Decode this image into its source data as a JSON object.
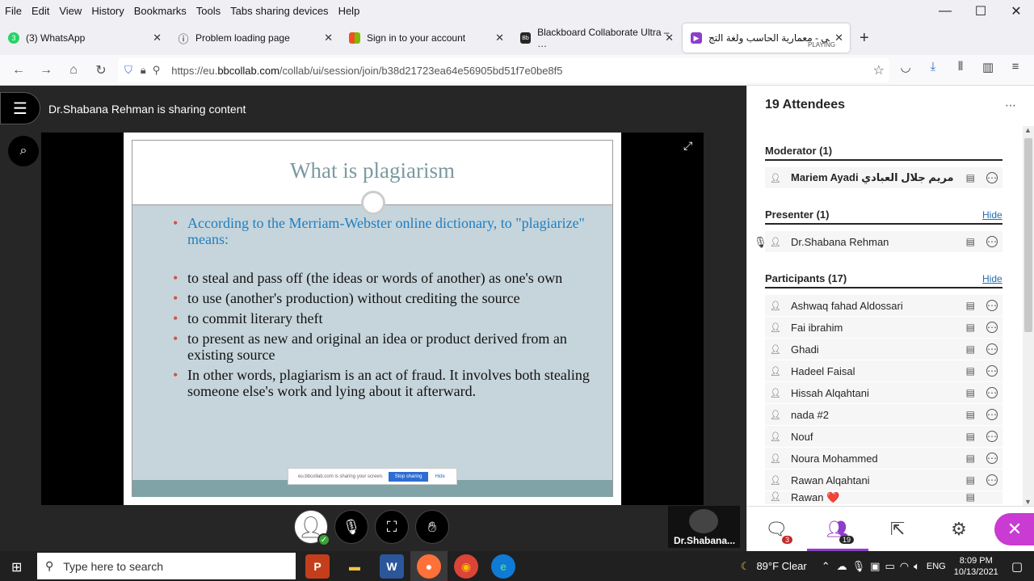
{
  "menubar": {
    "items": [
      "File",
      "Edit",
      "View",
      "History",
      "Bookmarks",
      "Tools",
      "Tabs sharing devices",
      "Help"
    ]
  },
  "window_controls": {
    "minimize": "—",
    "maximize": "☐",
    "close": "✕"
  },
  "tabs": [
    {
      "label": "(3) WhatsApp",
      "icon": "whatsapp-icon",
      "color": "#25d366",
      "glyph": "3"
    },
    {
      "label": "Problem loading page",
      "icon": "info-icon",
      "color": "#ffffff",
      "glyph": "ⓘ"
    },
    {
      "label": "Sign in to your account",
      "icon": "microsoft-icon",
      "color": "#f25022",
      "glyph": ""
    },
    {
      "label": "Blackboard Collaborate Ultra – …",
      "icon": "blackboard-icon",
      "color": "#262626",
      "glyph": "Bb"
    },
    {
      "label": "عملي - معمارية الحاسب ولغة التج",
      "sublabel": "PLAYING",
      "icon": "collaborate-icon",
      "color": "#8e3ec9",
      "glyph": "▶"
    }
  ],
  "tab_close": "✕",
  "new_tab": "+",
  "url": {
    "prefix": "https://eu.",
    "domain": "bbcollab.com",
    "path": "/collab/ui/session/join/b38d21723ea64e56905bd51f7e0be8f5"
  },
  "session": {
    "sharing_text": "Dr.Shabana Rehman is sharing content"
  },
  "slide": {
    "title": "What is plagiarism",
    "intro": "According to the Merriam-Webster online dictionary, to \"plagiarize\" means:",
    "bullets": [
      "to steal and pass off (the ideas or words of another) as one's own",
      "to use (another's production) without crediting the source",
      "to commit literary theft",
      "to present as new and original an idea or product derived from an existing source",
      "In other words, plagiarism is an act of fraud. It involves both stealing someone else's work and lying about it afterward."
    ],
    "share_notice": "eu.bbcollab.com is sharing your screen.",
    "stop_label": "Stop sharing",
    "hide_label": "Hide"
  },
  "presenter_thumb": {
    "name": "Dr.Shabana..."
  },
  "panel": {
    "title": "19 Attendees",
    "moderator": {
      "title": "Moderator (1)",
      "people": [
        "Mariem Ayadi مريم جلال العبادي"
      ]
    },
    "presenter": {
      "title": "Presenter (1)",
      "hide": "Hide",
      "people": [
        "Dr.Shabana Rehman"
      ]
    },
    "participants": {
      "title": "Participants (17)",
      "hide": "Hide",
      "people": [
        "Ashwaq fahad Aldossari",
        "Fai ibrahim",
        "Ghadi",
        "Hadeel Faisal",
        "Hissah Alqahtani",
        "nada #2",
        "Nouf",
        "Noura Mohammed",
        "Rawan Alqahtani",
        "Rawan ❤️"
      ]
    }
  },
  "bottom": {
    "chat_count": "3",
    "attendee_count": "19"
  },
  "taskbar": {
    "search_placeholder": "Type here to search",
    "weather": "89°F  Clear",
    "lang": "ENG",
    "time": "8:09 PM",
    "date": "10/13/2021"
  }
}
